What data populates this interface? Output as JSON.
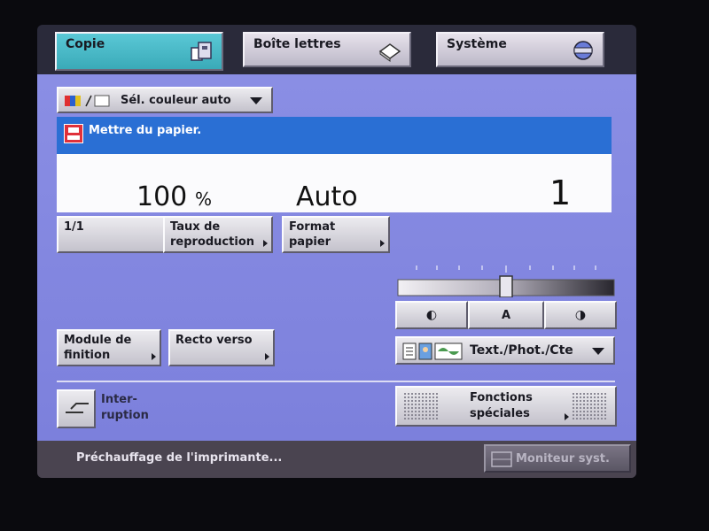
{
  "tabs": [
    {
      "label": "Copie",
      "icon": "copy-icon"
    },
    {
      "label": "Boîte lettres",
      "icon": "mailbox-icon"
    },
    {
      "label": "Système",
      "icon": "system-icon"
    }
  ],
  "color_select": {
    "label": "Sél. couleur auto",
    "icon": "color-mode-icon"
  },
  "message": {
    "text": "Mettre du papier.",
    "icon": "paper-alert-icon"
  },
  "readout": {
    "ratio": "100",
    "ratio_unit": "%",
    "paper": "Auto",
    "copies": "1"
  },
  "buttons": {
    "one_to_one": "1/1",
    "reproduction_1": "Taux de",
    "reproduction_2": "reproduction",
    "format_1": "Format",
    "format_2": "papier",
    "finisher_1": "Module de",
    "finisher_2": "finition",
    "duplex": "Recto verso",
    "interrupt_1": "Inter-",
    "interrupt_2": "ruption",
    "special_1": "Fonctions",
    "special_2": "spéciales"
  },
  "density": {
    "light_label": "◐",
    "auto_label": "A",
    "dark_label": "◑",
    "level": 0.5
  },
  "original_type": {
    "label": "Text./Phot./Cte"
  },
  "status_text": "Préchauffage de l'imprimante...",
  "monitor_button": "Moniteur syst.",
  "colors": {
    "panel": "#7c80dc",
    "message_bar": "#2a6fd4",
    "active_tab": "#4ab8c6"
  }
}
